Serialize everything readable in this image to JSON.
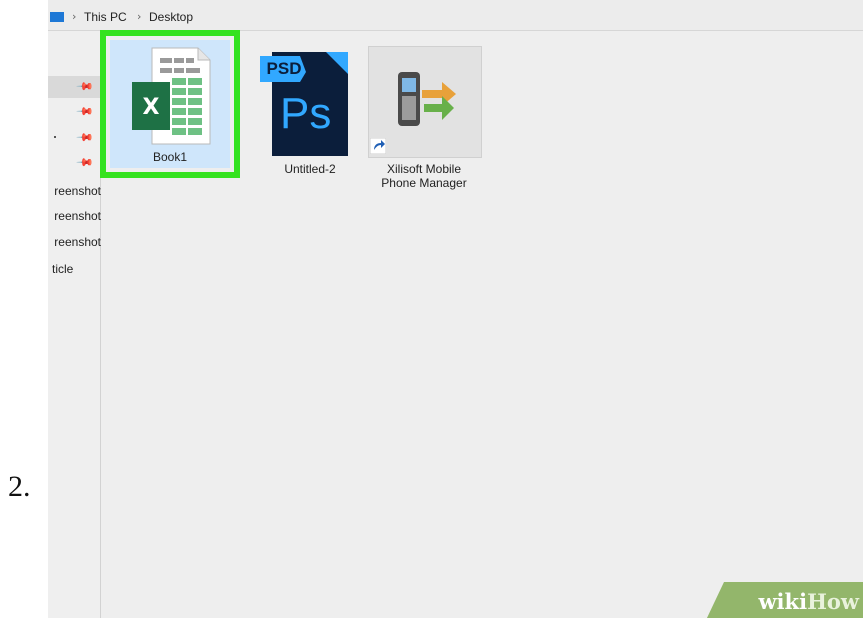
{
  "step_number": "2.",
  "address_bar": {
    "crumb_1": "This PC",
    "separator": "›",
    "crumb_2": "Desktop"
  },
  "nav": {
    "labels": [
      "reenshot",
      "reenshot",
      "reenshot",
      "ticle"
    ]
  },
  "files": [
    {
      "name": "Book1",
      "icon": "excel-icon"
    },
    {
      "name": "Untitled-2",
      "icon": "photoshop-psd-icon",
      "badge": "PSD",
      "logo": "Ps"
    },
    {
      "name_line1": "Xilisoft Mobile",
      "name_line2": "Phone Manager",
      "icon": "mobile-phone-manager-icon"
    }
  ],
  "watermark": {
    "part1": "wiki",
    "part2": "How"
  },
  "colors": {
    "highlight": "#35e21f",
    "selection": "#cfe6fb",
    "excel_green": "#1e7145",
    "ps_dark": "#0b1e3b",
    "ps_blue": "#31a8ff"
  }
}
